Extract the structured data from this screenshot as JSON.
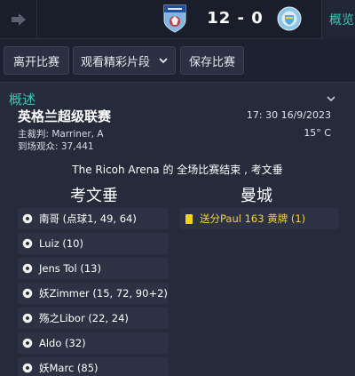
{
  "header": {
    "score": "12 - 0",
    "active_tab": "概览",
    "home_team_crest": "coventry-city-crest",
    "away_team_crest": "manchester-city-crest"
  },
  "toolbar": {
    "leave_match": "离开比赛",
    "watch_highlights": "观看精彩片段",
    "save_match": "保存比赛"
  },
  "overview": {
    "section_title": "概述",
    "competition": "英格兰超级联赛",
    "datetime": "17: 30 16/9/2023",
    "referee": "主裁判: Marriner, A",
    "attendance": "到场观众: 37,441",
    "temperature": "15° C",
    "summary": "The Ricoh Arena 的 全场比赛结束 , 考文垂"
  },
  "teams": {
    "home": {
      "name": "考文垂",
      "events": [
        "南哥 (点球1, 49, 64)",
        "Luiz (10)",
        "Jens Tol (13)",
        "妖Zimmer (15, 72, 90+2)",
        "殇之Libor (22, 24)",
        "Aldo (32)",
        "妖Marc (85)"
      ]
    },
    "away": {
      "name": "曼城",
      "events": [
        "送分Paul 163 黄牌 (1)"
      ]
    }
  },
  "colors": {
    "accent": "#3fc5b4",
    "yellow_card": "#f4d21a",
    "background": "#1d2230"
  }
}
